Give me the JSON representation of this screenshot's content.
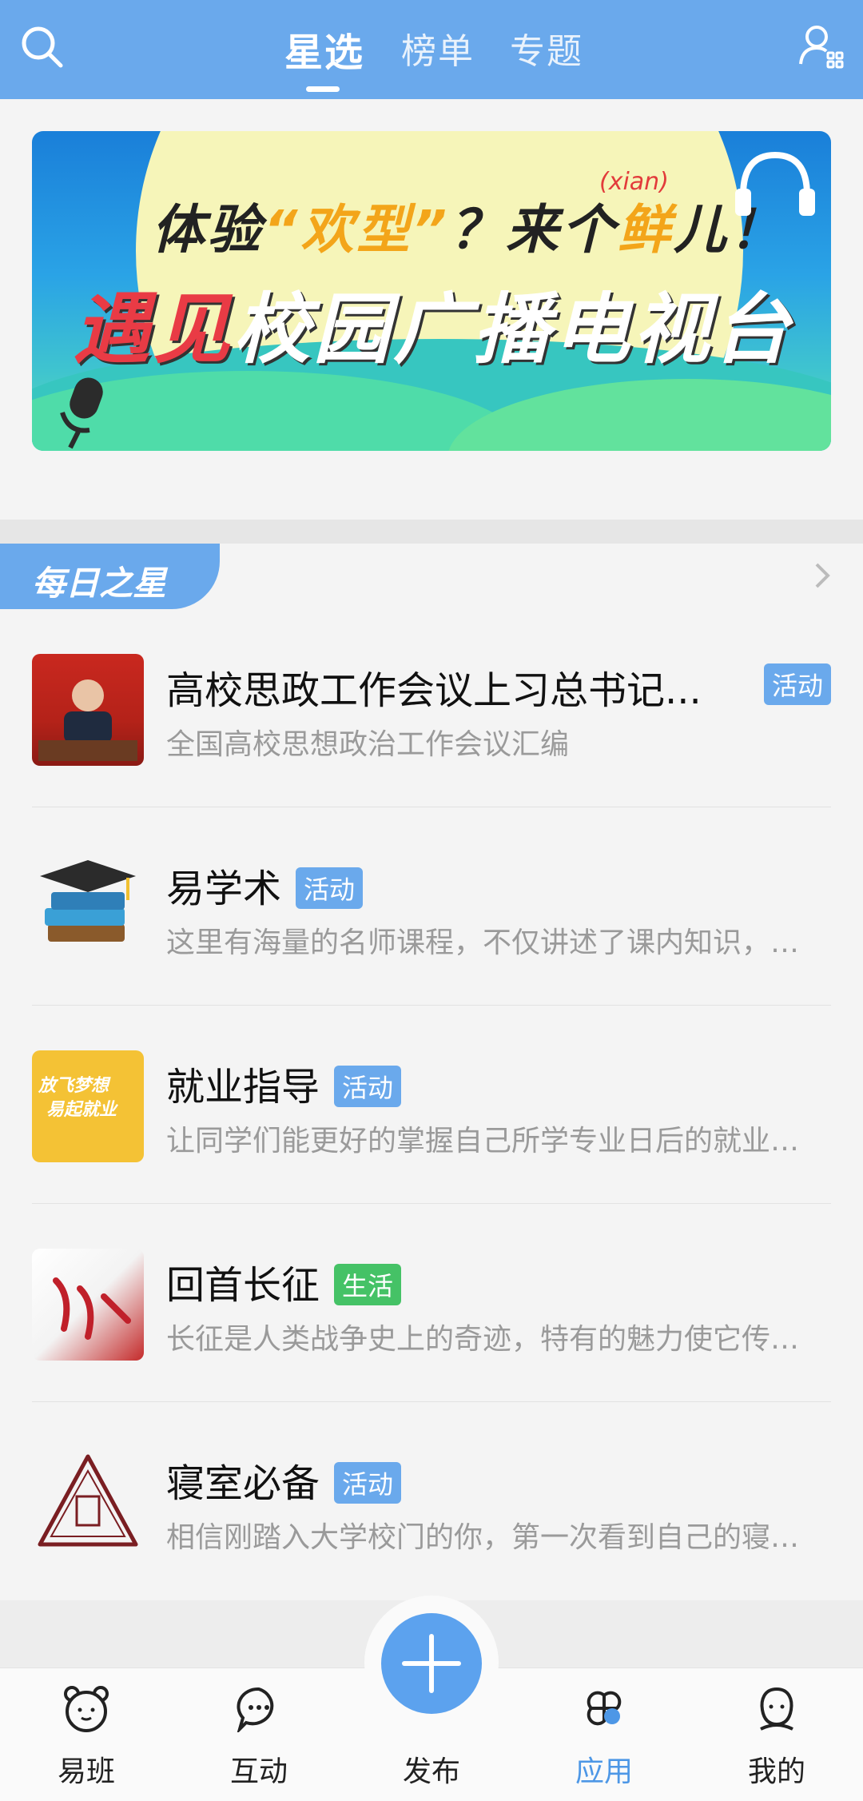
{
  "header": {
    "tabs": [
      {
        "label": "星选",
        "active": true
      },
      {
        "label": "榜单",
        "active": false
      },
      {
        "label": "专题",
        "active": false
      }
    ],
    "icons": {
      "left": "search-icon",
      "right": "profile-settings-icon"
    }
  },
  "banner": {
    "line1_a": "体验",
    "line1_quote": "“欢型”",
    "line1_b": "？来个",
    "line1_hl": "鲜",
    "line1_c": "儿！",
    "pinyin": "(xian)",
    "line2_red": "遇见",
    "line2_rest": "校园广播电视台"
  },
  "section": {
    "title": "每日之星"
  },
  "items": [
    {
      "title": "高校思政工作会议上习总书记...",
      "badge": "活动",
      "subtitle": "全国高校思想政治工作会议汇编"
    },
    {
      "title": "易学术",
      "badge": "活动",
      "subtitle": "这里有海量的名师课程，不仅讲述了课内知识，还有课外拓展"
    },
    {
      "title": "就业指导",
      "badge": "活动",
      "subtitle": "让同学们能更好的掌握自己所学专业日后的就业方向与技能",
      "thumb_text1": "放飞梦想",
      "thumb_text2": "易起就业"
    },
    {
      "title": "回首长征",
      "badge": "生活",
      "subtitle": "长征是人类战争史上的奇迹，特有的魅力使它传颂至今"
    },
    {
      "title": "寝室必备",
      "badge": "活动",
      "subtitle": "相信刚踏入大学校门的你，第一次看到自己的寝室时会..."
    }
  ],
  "bottom_nav": [
    {
      "label": "易班",
      "icon": "bear-icon",
      "active": false
    },
    {
      "label": "互动",
      "icon": "chat-bubble-icon",
      "active": false
    },
    {
      "label": "发布",
      "icon": "plus-icon",
      "active": false
    },
    {
      "label": "应用",
      "icon": "apps-icon",
      "active": true
    },
    {
      "label": "我的",
      "icon": "person-icon",
      "active": false
    }
  ],
  "colors": {
    "primary": "#6aa9ec",
    "active_nav": "#4d97e6",
    "badge_green": "#45c266"
  }
}
